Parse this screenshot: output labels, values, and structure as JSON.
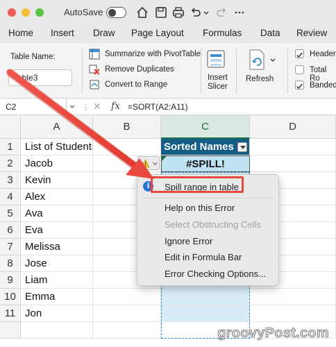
{
  "titlebar": {
    "autosave_label": "AutoSave"
  },
  "tabs": [
    "Home",
    "Insert",
    "Draw",
    "Page Layout",
    "Formulas",
    "Data",
    "Review"
  ],
  "ribbon": {
    "table_name_label": "Table Name:",
    "table_name_value": "Table3",
    "commands": [
      "Summarize with PivotTable",
      "Remove Duplicates",
      "Convert to Range"
    ],
    "insert_slicer": [
      "Insert",
      "Slicer"
    ],
    "refresh": "Refresh",
    "style_options": [
      {
        "label": "Header",
        "checked": true
      },
      {
        "label": "Total Ro",
        "checked": false
      },
      {
        "label": "Banded",
        "checked": true
      }
    ]
  },
  "formula_bar": {
    "cell_ref": "C2",
    "fx": "fx",
    "formula": "=SORT(A2:A11)"
  },
  "columns": [
    "A",
    "B",
    "C",
    "D"
  ],
  "rows": [
    "1",
    "2",
    "3",
    "4",
    "5",
    "6",
    "7",
    "8",
    "9",
    "10",
    "11"
  ],
  "cells": {
    "a": [
      "List of Students",
      "Jacob",
      "Kevin",
      "Alex",
      "Ava",
      "Eva",
      "Melissa",
      "Jose",
      "Liam",
      "Emma",
      "Jon"
    ],
    "c_header": "Sorted Names",
    "c_error": "#SPILL!"
  },
  "context_menu": {
    "items": [
      "Spill range in table",
      "Help on this Error",
      "Select Obstructing Cells",
      "Ignore Error",
      "Edit in Formula Bar",
      "Error Checking Options..."
    ]
  },
  "watermark": "groovyPost.com",
  "colors": {
    "table_header": "#175e86",
    "spill_fill": "#d7ecf6",
    "highlight": "#e8483e"
  }
}
